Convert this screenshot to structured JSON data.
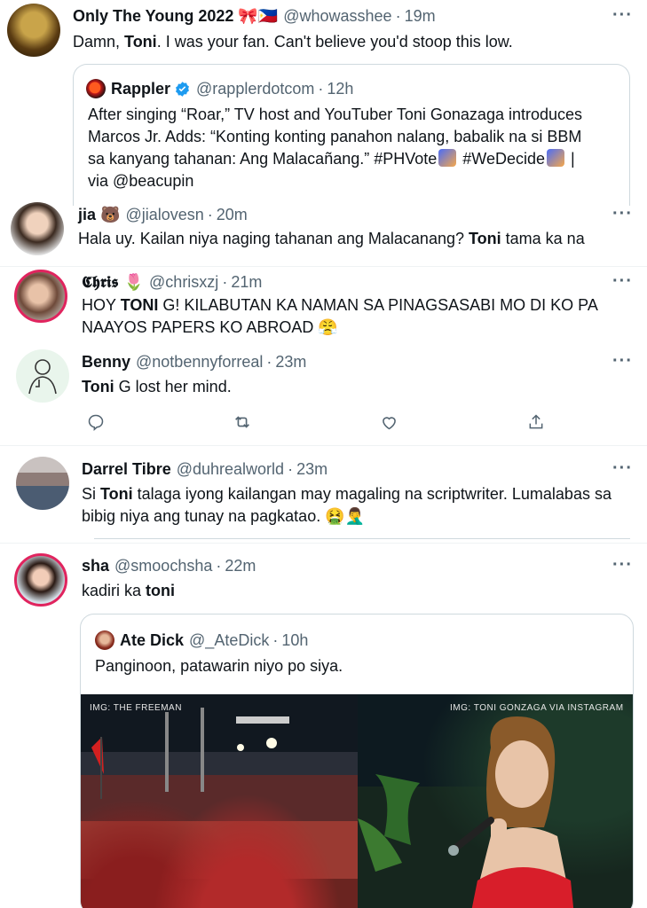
{
  "tweets": [
    {
      "name": "Only The Young 2022 🎀🇵🇭",
      "handle": "@whowasshee",
      "time": "19m",
      "text_pre": "Damn, ",
      "text_bold": "Toni",
      "text_post": ". I was your fan. Can't believe you'd stoop this low.",
      "quote": {
        "name": "Rappler",
        "handle": "@rapplerdotcom",
        "time": "12h",
        "text_line1": "After singing “Roar,” TV host and YouTuber Toni Gonazaga introduces",
        "text_line2": "Marcos Jr. Adds: “Konting konting panahon nalang, babalik na si BBM",
        "text_line3": "sa kanyang tahanan: Ang Malacañang.” #PHVote",
        "text_line3b": " #WeDecide",
        "text_line3c": " |",
        "text_line4": "via @beacupin"
      }
    },
    {
      "name": "jia 🐻",
      "handle": "@jialovesn",
      "time": "20m",
      "text_pre": "Hala uy. Kailan niya naging tahanan ang Malacanang? ",
      "text_bold": "Toni",
      "text_post": " tama ka na"
    },
    {
      "name": "𝕮𝖍𝖗𝖎𝖘 🌷",
      "handle": "@chrisxzj",
      "time": "21m",
      "text_line1_pre": "HOY ",
      "text_line1_bold": "TONI",
      "text_line1_post": " G! KILABUTAN KA NAMAN SA PINAGSASABI MO DI KO PA",
      "text_line2": "NAAYOS PAPERS KO ABROAD 😤"
    },
    {
      "name": "Benny",
      "handle": "@notbennyforreal",
      "time": "23m",
      "text_bold": "Toni",
      "text_post": " G lost her mind."
    },
    {
      "name": "Darrel Tibre",
      "handle": "@duhrealworld",
      "time": "23m",
      "text_line1_pre": "Si ",
      "text_line1_bold": "Toni",
      "text_line1_post": " talaga iyong kailangan may magaling na scriptwriter. Lumalabas sa",
      "text_line2": "bibig niya ang tunay na pagkatao. 🤮🤦‍♂️"
    },
    {
      "name": "sha",
      "handle": "@smoochsha",
      "time": "22m",
      "text_pre": "kadiri ka ",
      "text_bold": "toni",
      "quote": {
        "name": "Ate Dick",
        "handle": "@_AteDick",
        "time": "10h",
        "text": "Panginoon, patawarin niyo po siya.",
        "caption_left": "IMG: THE FREEMAN",
        "caption_right": "IMG: TONI GONZAGA VIA INSTAGRAM"
      }
    }
  ],
  "dot": "·",
  "more": "···",
  "colors": {
    "accent": "#1d9bf0",
    "ring": "#e0245e",
    "muted": "#536471"
  }
}
